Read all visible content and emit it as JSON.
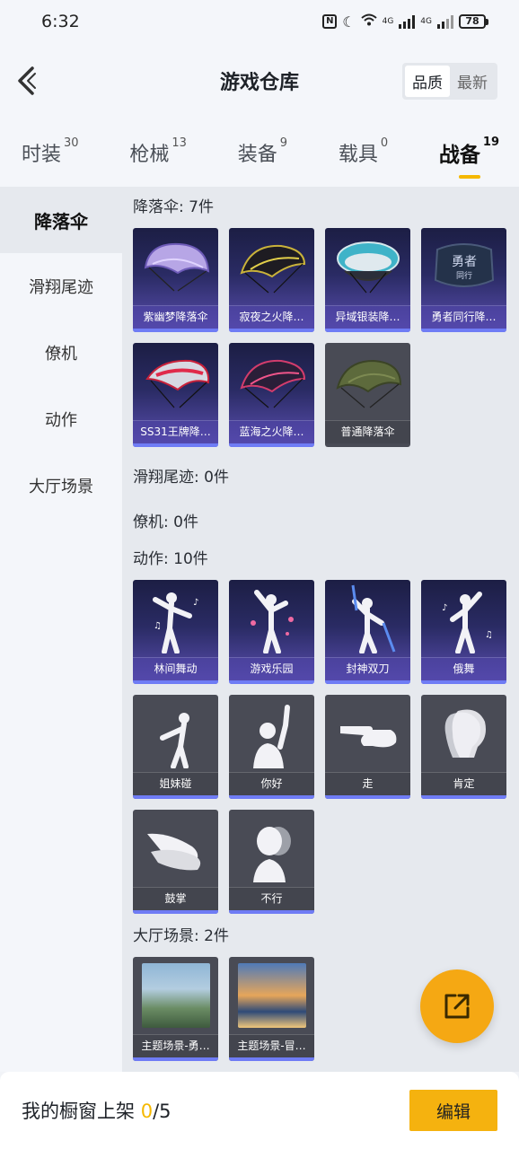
{
  "status": {
    "time": "6:32",
    "battery": "78",
    "signal1": "4G",
    "signal2": "4G"
  },
  "header": {
    "title": "游戏仓库",
    "sort_quality": "品质",
    "sort_newest": "最新"
  },
  "tabs": [
    {
      "label": "时装",
      "count": "30"
    },
    {
      "label": "枪械",
      "count": "13"
    },
    {
      "label": "装备",
      "count": "9"
    },
    {
      "label": "载具",
      "count": "0"
    },
    {
      "label": "战备",
      "count": "19"
    }
  ],
  "sidebar": {
    "items": [
      {
        "label": "降落伞"
      },
      {
        "label": "滑翔尾迹"
      },
      {
        "label": "僚机"
      },
      {
        "label": "动作"
      },
      {
        "label": "大厅场景"
      }
    ]
  },
  "sections": {
    "parachute": {
      "title": "降落伞: 7件",
      "items": [
        {
          "name": "紫幽梦降落伞",
          "art": "parachute-icon"
        },
        {
          "name": "寂夜之火降…",
          "art": "parachute-icon"
        },
        {
          "name": "异域银装降…",
          "art": "parachute-icon"
        },
        {
          "name": "勇者同行降…",
          "art": "parachute-icon"
        },
        {
          "name": "SS31王牌降…",
          "art": "parachute-icon"
        },
        {
          "name": "蓝海之火降…",
          "art": "parachute-icon"
        },
        {
          "name": "普通降落伞",
          "art": "parachute-icon"
        }
      ]
    },
    "trail": {
      "title": "滑翔尾迹: 0件"
    },
    "wingman": {
      "title": "僚机: 0件"
    },
    "emote": {
      "title": "动作: 10件",
      "items": [
        {
          "name": "林间舞动",
          "art": "dance-figure-icon"
        },
        {
          "name": "游戏乐园",
          "art": "dance-figure-icon"
        },
        {
          "name": "封神双刀",
          "art": "dance-figure-icon"
        },
        {
          "name": "俄舞",
          "art": "dance-figure-icon"
        },
        {
          "name": "姐妹碰",
          "art": "figure-icon"
        },
        {
          "name": "你好",
          "art": "wave-figure-icon"
        },
        {
          "name": "走",
          "art": "pointing-hand-icon"
        },
        {
          "name": "肯定",
          "art": "nodding-head-icon"
        },
        {
          "name": "鼓掌",
          "art": "clapping-hands-icon"
        },
        {
          "name": "不行",
          "art": "shaking-head-icon"
        }
      ]
    },
    "lobby": {
      "title": "大厅场景: 2件",
      "items": [
        {
          "name": "主题场景-勇…",
          "art": "landscape-icon"
        },
        {
          "name": "主题场景-冒…",
          "art": "landscape-icon"
        }
      ]
    }
  },
  "bottom": {
    "label": "我的橱窗上架",
    "count": "0",
    "total": "/5",
    "edit": "编辑"
  },
  "colors": {
    "accent": "#f5b20f",
    "rare_bar": "#6f7cf5",
    "purple_card": "#2a2b64",
    "gray_card": "#494b55"
  }
}
